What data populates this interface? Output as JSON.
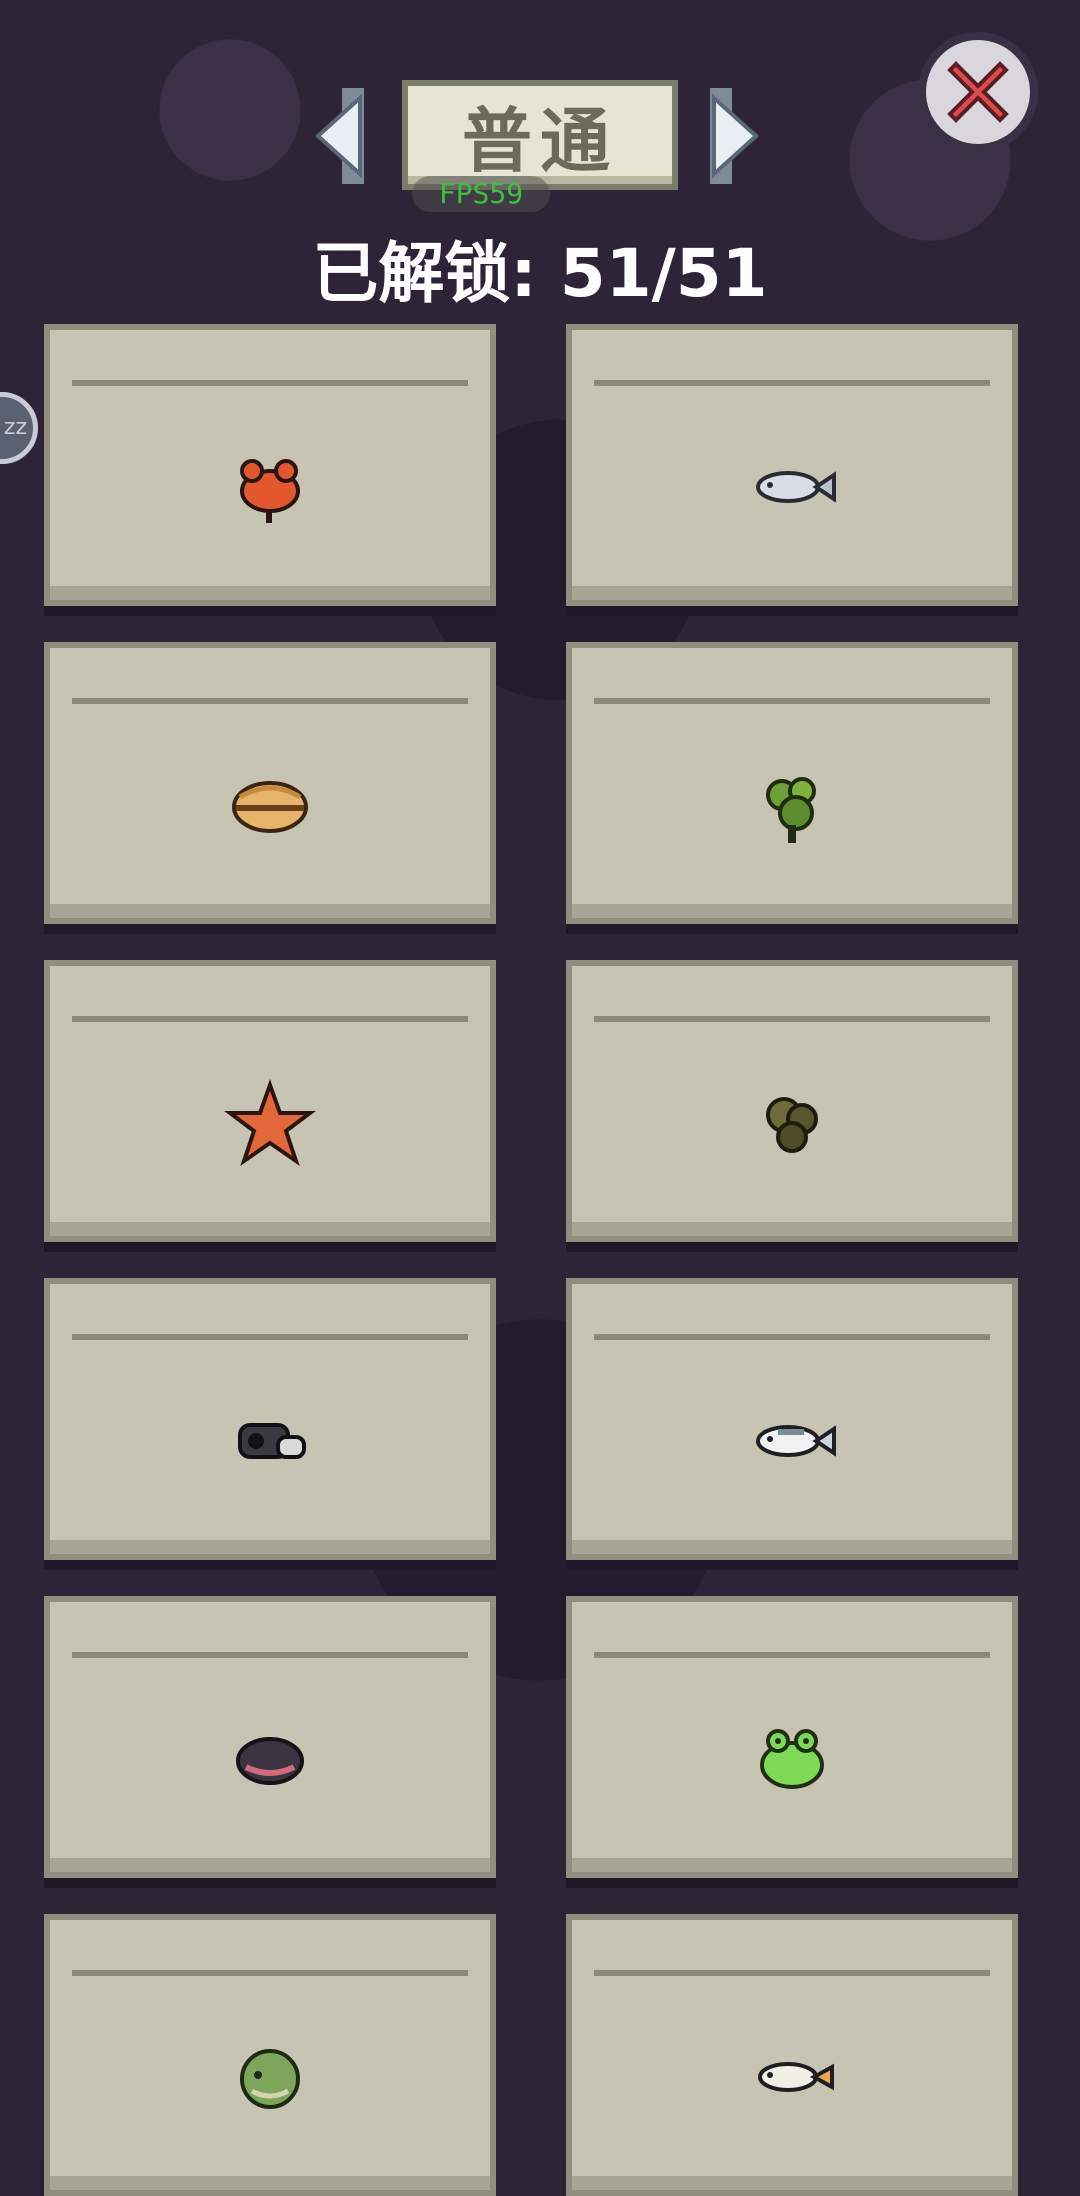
{
  "header": {
    "mode_label": "普通",
    "fps_label": "FPS59",
    "unlocked_text": "已解锁: 51/51"
  },
  "icons": {
    "prev": "triangle-left-icon",
    "next": "triangle-right-icon",
    "close": "close-x-icon"
  },
  "colors": {
    "background": "#2e2438",
    "card": "#c7c4b4",
    "mode_box": "#e6e5d4",
    "close_x": "#e04a4a",
    "fps_text": "#3fbf3f"
  },
  "items": [
    {
      "icon": "red-crab-icon"
    },
    {
      "icon": "silver-fish-icon"
    },
    {
      "icon": "clam-shell-icon"
    },
    {
      "icon": "green-seaweed-icon"
    },
    {
      "icon": "orange-starfish-icon"
    },
    {
      "icon": "dark-seaweed-icon"
    },
    {
      "icon": "black-boot-icon"
    },
    {
      "icon": "white-fish-icon"
    },
    {
      "icon": "dark-shell-icon"
    },
    {
      "icon": "green-frog-icon"
    },
    {
      "icon": "green-pufferfish-icon"
    },
    {
      "icon": "small-fish-icon"
    }
  ]
}
